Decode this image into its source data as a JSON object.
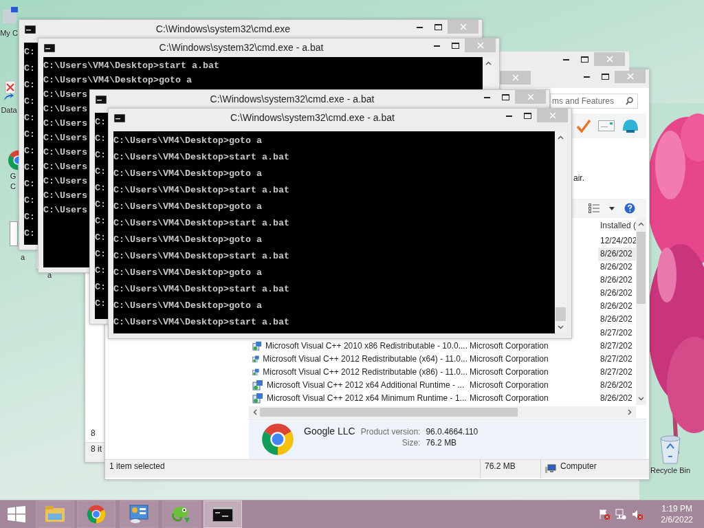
{
  "desktop_icons": [
    {
      "kind": "computer",
      "lines": [
        "My C"
      ]
    },
    {
      "kind": "shortcut",
      "lines": [
        "Data"
      ]
    },
    {
      "kind": "chrome",
      "lines": [
        "G",
        "C"
      ]
    },
    {
      "kind": "file"
    },
    {
      "kind": "blank",
      "lines": [
        "a"
      ]
    },
    {
      "kind": "gear",
      "lines": [
        "a"
      ]
    }
  ],
  "recycle_bin": {
    "label": "Recycle Bin"
  },
  "windows": [
    {
      "kind": "explorer_back",
      "visible_cell": "8",
      "status": "8 it"
    },
    {
      "kind": "explorer",
      "search": {
        "placeholder": "ms and Features"
      },
      "info_text": "air.",
      "columns": [
        {
          "label": "Installed ("
        }
      ],
      "programs": [
        {
          "installed": "12/24/202",
          "selected": false
        },
        {
          "installed": "8/26/202",
          "selected": true
        },
        {
          "installed": "8/26/202",
          "selected": false
        },
        {
          "installed": "8/26/202",
          "selected": false
        },
        {
          "installed": "8/26/202",
          "selected": false
        },
        {
          "installed": "8/26/202",
          "selected": false
        },
        {
          "installed": "8/26/202",
          "selected": false
        },
        {
          "installed": "8/27/202",
          "selected": false
        },
        {
          "name": "Microsoft Visual C++ 2010  x86 Redistributable - 10.0....",
          "publisher": "Microsoft Corporation",
          "installed": "8/27/202",
          "selected": false
        },
        {
          "name": "Microsoft Visual C++ 2012 Redistributable (x64) - 11.0...",
          "publisher": "Microsoft Corporation",
          "installed": "8/27/202",
          "selected": false
        },
        {
          "name": "Microsoft Visual C++ 2012 Redistributable (x86) - 11.0...",
          "publisher": "Microsoft Corporation",
          "installed": "8/27/202",
          "selected": false
        },
        {
          "name": "Microsoft Visual C++ 2012 x64 Additional Runtime - ...",
          "publisher": "Microsoft Corporation",
          "installed": "8/26/202",
          "selected": false
        },
        {
          "name": "Microsoft Visual C++ 2012 x64 Minimum Runtime - 1...",
          "publisher": "Microsoft Corporation",
          "installed": "8/26/202",
          "selected": false
        }
      ],
      "details": {
        "publisher": "Google LLC",
        "version_label": "Product version:",
        "version": "96.0.4664.110",
        "size_label": "Size:",
        "size": "76.2 MB"
      },
      "status_bar": {
        "selection": "1 item selected",
        "size": "76.2 MB",
        "zone": "Computer"
      }
    },
    {
      "kind": "stub"
    },
    {
      "kind": "stub"
    },
    {
      "kind": "cmd",
      "title": "C:\\Windows\\system32\\cmd.exe",
      "lines": [
        "C:",
        "C:",
        "C:",
        "C:",
        "C:",
        "C:",
        "C:",
        "C:",
        "C:",
        "C:",
        "C:",
        "C:"
      ]
    },
    {
      "kind": "cmd",
      "title": "C:\\Windows\\system32\\cmd.exe - a.bat",
      "lines": [
        "C:\\Users\\VM4\\Desktop>start a.bat",
        "C:\\Users\\VM4\\Desktop>goto a",
        "C:\\Users",
        "C:\\Users",
        "C:\\Users",
        "C:\\Users",
        "C:\\Users",
        "C:\\Users",
        "C:\\Users",
        "C:\\Users",
        "C:\\Users"
      ]
    },
    {
      "kind": "cmd",
      "title": "C:\\Windows\\system32\\cmd.exe - a.bat",
      "lines": [
        "C:",
        "C:",
        "C:",
        "C:",
        "C:",
        "C:",
        "C:",
        "C:",
        "C:",
        "C:",
        "C:",
        "C:"
      ]
    },
    {
      "kind": "cmd",
      "title": "C:\\Windows\\system32\\cmd.exe - a.bat",
      "lines": [
        "C:\\Users\\VM4\\Desktop>goto a",
        "C:\\Users\\VM4\\Desktop>start a.bat",
        "C:\\Users\\VM4\\Desktop>goto a",
        "C:\\Users\\VM4\\Desktop>start a.bat",
        "C:\\Users\\VM4\\Desktop>goto a",
        "C:\\Users\\VM4\\Desktop>start a.bat",
        "C:\\Users\\VM4\\Desktop>goto a",
        "C:\\Users\\VM4\\Desktop>start a.bat",
        "C:\\Users\\VM4\\Desktop>goto a",
        "C:\\Users\\VM4\\Desktop>start a.bat",
        "C:\\Users\\VM4\\Desktop>goto a",
        "C:\\Users\\VM4\\Desktop>start a.bat"
      ]
    }
  ],
  "taskbar": {
    "apps": [
      {
        "kind": "explorer",
        "selected": false
      },
      {
        "kind": "chrome",
        "selected": false
      },
      {
        "kind": "control_panel",
        "selected": false
      },
      {
        "kind": "lizard",
        "selected": false
      },
      {
        "kind": "cmd",
        "selected": true
      }
    ],
    "clock": {
      "time": "1:19 PM",
      "date": "2/6/2022"
    }
  }
}
